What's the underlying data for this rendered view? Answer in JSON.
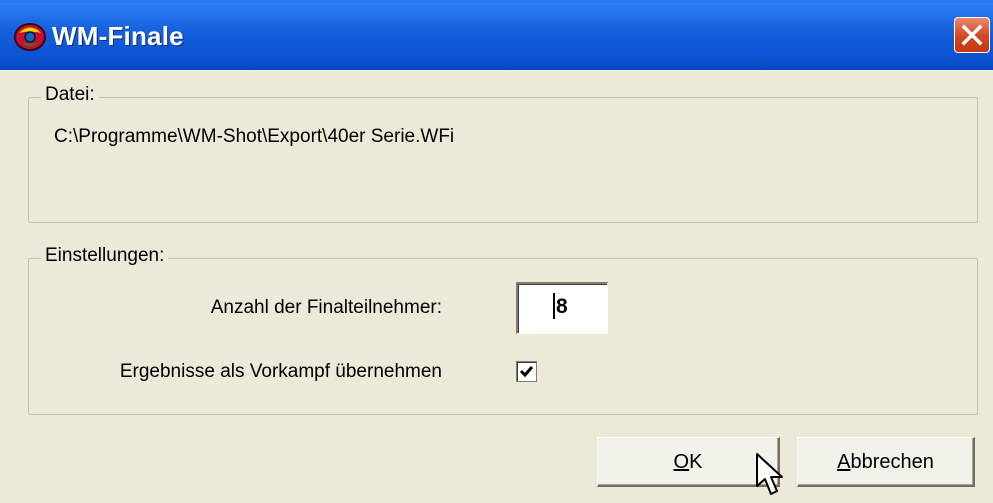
{
  "window": {
    "title": "WM-Finale",
    "icon": "app-icon",
    "close_icon": "close-icon"
  },
  "datei": {
    "legend": "Datei:",
    "path": "C:\\Programme\\WM-Shot\\Export\\40er Serie.WFi"
  },
  "einstellungen": {
    "legend": "Einstellungen:",
    "finalists_label": "Anzahl der Finalteilnehmer:",
    "finalists_value": "8",
    "results_label": "Ergebnisse als Vorkampf übernehmen",
    "results_checked": true
  },
  "buttons": {
    "ok_mnemonic": "O",
    "ok_rest": "K",
    "cancel_mnemonic": "A",
    "cancel_rest": "bbrechen"
  },
  "colors": {
    "titlebar": "#0a53d2",
    "dialog_bg": "#ece9d8",
    "close_button": "#d2451f"
  }
}
